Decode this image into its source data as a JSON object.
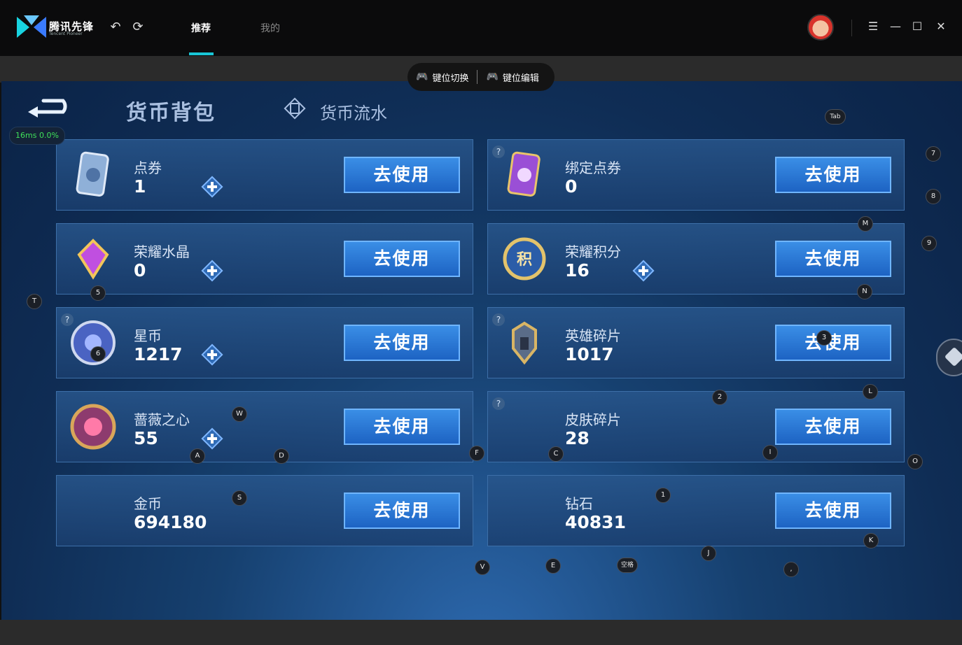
{
  "app": {
    "logo_text": "腾讯先锋",
    "logo_subtext": "Tencent Pioneer",
    "tabs": [
      {
        "label": "推荐",
        "active": true
      },
      {
        "label": "我的",
        "active": false
      }
    ]
  },
  "toolbar": {
    "key_switch_label": "键位切换",
    "key_edit_label": "键位编辑"
  },
  "perf": {
    "text": "16ms  0.0%"
  },
  "page": {
    "title": "货币背包",
    "flow_tab": "货币流水"
  },
  "currencies": [
    {
      "name": "点券",
      "amount": "1",
      "use_label": "去使用",
      "plus": true,
      "icon": "ticket-icon"
    },
    {
      "name": "绑定点券",
      "amount": "0",
      "use_label": "去使用",
      "plus": false,
      "icon": "bound-ticket-icon"
    },
    {
      "name": "荣耀水晶",
      "amount": "0",
      "use_label": "去使用",
      "plus": true,
      "icon": "crystal-icon"
    },
    {
      "name": "荣耀积分",
      "amount": "16",
      "use_label": "去使用",
      "plus": true,
      "icon": "honor-points-icon"
    },
    {
      "name": "星币",
      "amount": "1217",
      "use_label": "去使用",
      "plus": true,
      "icon": "star-coin-icon"
    },
    {
      "name": "英雄碎片",
      "amount": "1017",
      "use_label": "去使用",
      "plus": false,
      "icon": "hero-fragment-icon"
    },
    {
      "name": "蔷薇之心",
      "amount": "55",
      "use_label": "去使用",
      "plus": true,
      "icon": "rose-heart-icon"
    },
    {
      "name": "皮肤碎片",
      "amount": "28",
      "use_label": "去使用",
      "plus": false,
      "icon": "skin-fragment-icon"
    },
    {
      "name": "金币",
      "amount": "694180",
      "use_label": "去使用",
      "plus": false,
      "icon": "gold-coin-icon"
    },
    {
      "name": "钻石",
      "amount": "40831",
      "use_label": "去使用",
      "plus": false,
      "icon": "diamond-icon"
    }
  ],
  "keymap": [
    "Tab",
    "7",
    "8",
    "M",
    "9",
    "N",
    "T",
    "5",
    "6",
    "3",
    "L",
    "2",
    "W",
    "A",
    "D",
    "F",
    "C",
    "I",
    "O",
    "S",
    "1",
    "K",
    "J",
    "V",
    "E",
    "空格",
    ","
  ],
  "colors": {
    "accent": "#19c6d6",
    "button": "#1d63c3",
    "latency": "#3fe05a"
  }
}
